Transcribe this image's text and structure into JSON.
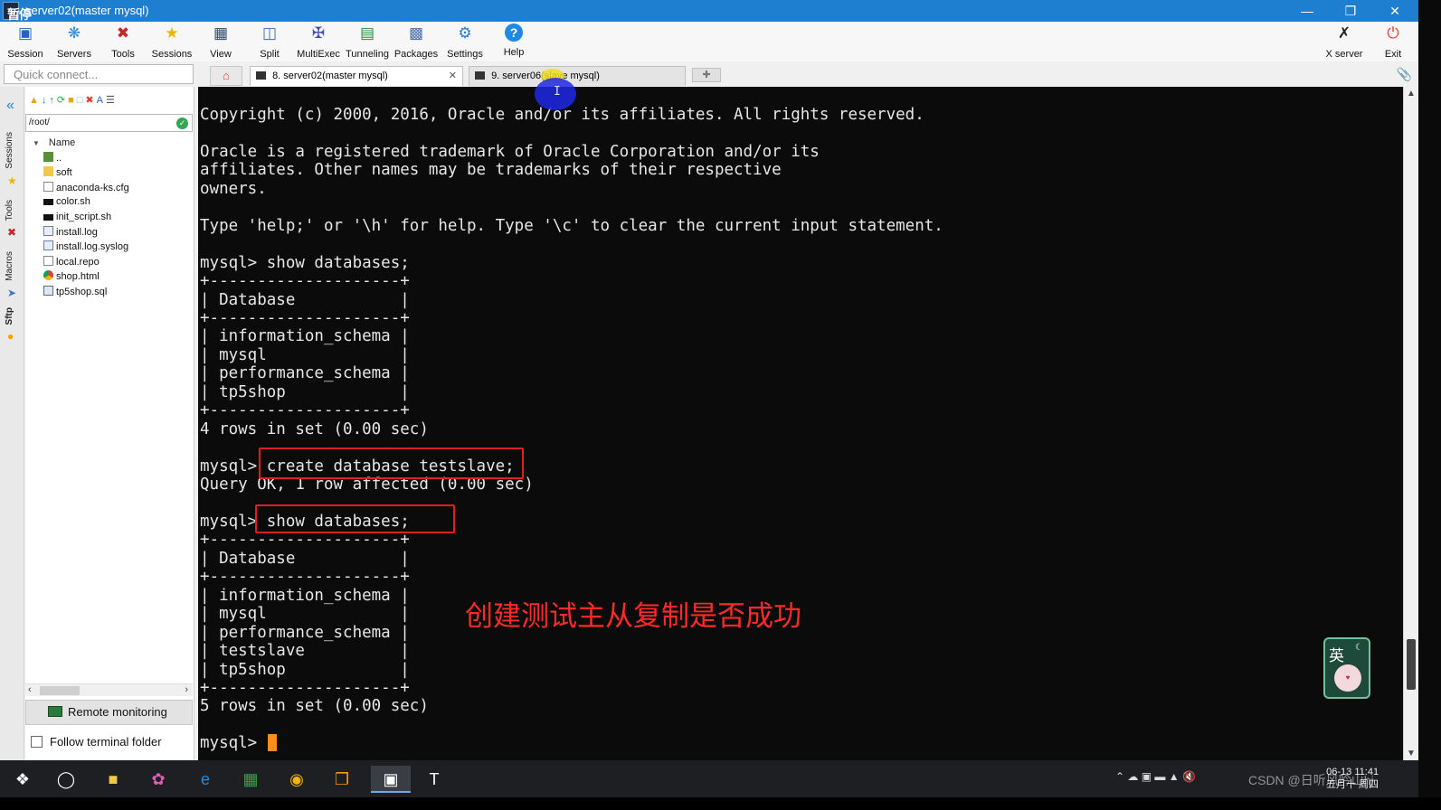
{
  "window": {
    "title": "server02(master mysql)",
    "paused_badge": "暂停"
  },
  "toolbar": {
    "items": [
      {
        "label": "Session",
        "icon": "session-icon"
      },
      {
        "label": "Servers",
        "icon": "servers-icon"
      },
      {
        "label": "Tools",
        "icon": "tools-icon"
      },
      {
        "label": "Sessions",
        "icon": "sessions-star-icon"
      },
      {
        "label": "View",
        "icon": "view-icon"
      },
      {
        "label": "Split",
        "icon": "split-icon"
      },
      {
        "label": "MultiExec",
        "icon": "multiexec-icon"
      },
      {
        "label": "Tunneling",
        "icon": "tunneling-icon"
      },
      {
        "label": "Packages",
        "icon": "packages-icon"
      },
      {
        "label": "Settings",
        "icon": "settings-icon"
      },
      {
        "label": "Help",
        "icon": "help-icon"
      }
    ],
    "xserver_label": "X server",
    "exit_label": "Exit"
  },
  "quick_connect": {
    "placeholder": "Quick connect..."
  },
  "tabs": [
    {
      "label": "8. server02(master mysql)",
      "active": true
    },
    {
      "label": "9. server06(slave mysql)",
      "active": false
    }
  ],
  "sidebar_tabs": [
    "Sessions",
    "Tools",
    "Macros",
    "Sftp"
  ],
  "file_panel": {
    "path": "/root/",
    "column_name": "Name",
    "files": [
      {
        "name": "..",
        "icon": "parent-folder-icon"
      },
      {
        "name": "soft",
        "icon": "folder-icon"
      },
      {
        "name": "anaconda-ks.cfg",
        "icon": "cfg-file-icon"
      },
      {
        "name": "color.sh",
        "icon": "shell-file-icon"
      },
      {
        "name": "init_script.sh",
        "icon": "shell-file-icon"
      },
      {
        "name": "install.log",
        "icon": "log-file-icon"
      },
      {
        "name": "install.log.syslog",
        "icon": "log-file-icon"
      },
      {
        "name": "local.repo",
        "icon": "file-icon"
      },
      {
        "name": "shop.html",
        "icon": "chrome-html-icon"
      },
      {
        "name": "tp5shop.sql",
        "icon": "sql-file-icon"
      }
    ],
    "remote_monitoring_label": "Remote monitoring",
    "follow_terminal_label": "Follow terminal folder"
  },
  "terminal": {
    "lines": [
      "Copyright (c) 2000, 2016, Oracle and/or its affiliates. All rights reserved.",
      "",
      "Oracle is a registered trademark of Oracle Corporation and/or its",
      "affiliates. Other names may be trademarks of their respective",
      "owners.",
      "",
      "Type 'help;' or '\\h' for help. Type '\\c' to clear the current input statement.",
      "",
      "mysql> show databases;",
      "+--------------------+",
      "| Database           |",
      "+--------------------+",
      "| information_schema |",
      "| mysql              |",
      "| performance_schema |",
      "| tp5shop            |",
      "+--------------------+",
      "4 rows in set (0.00 sec)",
      "",
      "mysql> create database testslave;",
      "Query OK, 1 row affected (0.00 sec)",
      "",
      "mysql> show databases;",
      "+--------------------+",
      "| Database           |",
      "+--------------------+",
      "| information_schema |",
      "| mysql              |",
      "| performance_schema |",
      "| testslave          |",
      "| tp5shop            |",
      "+--------------------+",
      "5 rows in set (0.00 sec)",
      "",
      "mysql> "
    ],
    "annotation": "创建测试主从复制是否成功",
    "highlight_color": "#e02020",
    "cursor_color": "#ff8c1a"
  },
  "ime": {
    "char": "英"
  },
  "taskbar": {
    "clock_time": "06-13 11:41",
    "clock_date": "五月十 周四",
    "watermark": "CSDN @日听风吟山hj"
  },
  "colors": {
    "titlebar": "#1e7fd0",
    "terminal_bg": "#0b0b0b",
    "terminal_fg": "#e6e6e6",
    "annotation": "#ff2a2a"
  }
}
